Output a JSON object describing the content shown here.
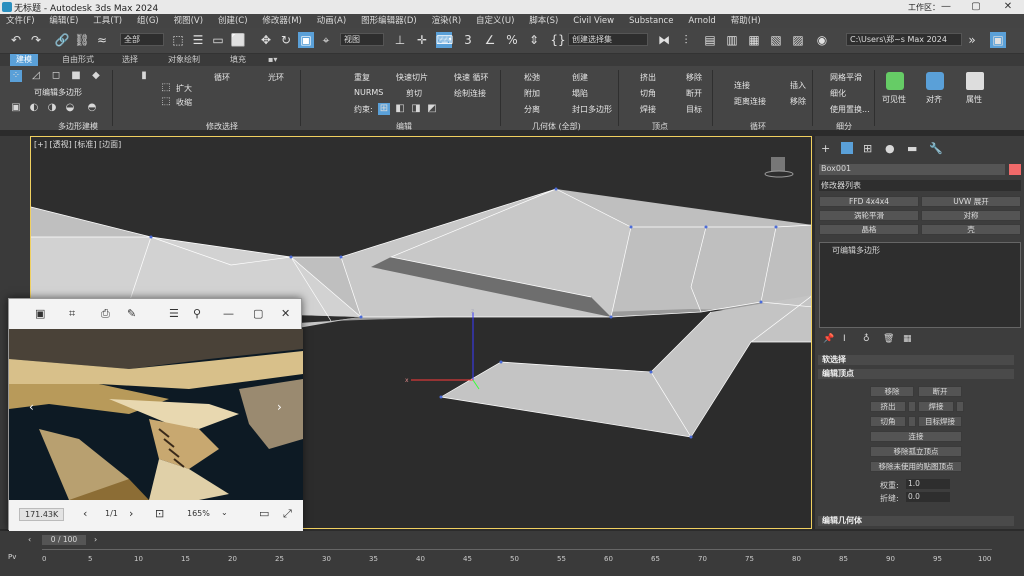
{
  "window": {
    "title": "无标题 - Autodesk 3ds Max 2024",
    "workspace": "工作区：",
    "minimize": "—",
    "maximize": "▢",
    "close": "✕"
  },
  "menu": [
    "文件(F)",
    "编辑(E)",
    "工具(T)",
    "组(G)",
    "视图(V)",
    "创建(C)",
    "修改器(M)",
    "动画(A)",
    "图形编辑器(D)",
    "渲染(R)",
    "自定义(U)",
    "脚本(S)",
    "Civil View",
    "Substance",
    "Arnold",
    "帮助(H)"
  ],
  "toolbar": {
    "selection_filter": "全部",
    "ref_coord": "视图",
    "named_sel": "创建选择集",
    "project_path": "C:\\Users\\郑~s Max 2024"
  },
  "ribbon_tabs": [
    "建模",
    "自由形式",
    "选择",
    "对象绘制",
    "填充"
  ],
  "ribbon": {
    "groups": [
      "多边形建模",
      "修改选择",
      "编辑",
      "几何体 (全部)",
      "顶点",
      "循环",
      "细分"
    ],
    "poly_label": "可编辑多边形",
    "sel": {
      "grow": "扩大",
      "shrink": "收缩",
      "loop": "循环",
      "ring": "光环"
    },
    "edit": {
      "repeat": "重复",
      "quickslice": "快速切片",
      "quickloop": "快速 循环",
      "nurms": "NURMS",
      "cut": "剪切",
      "drawconn": "绘制连接",
      "constraint": "约束:"
    },
    "geo": {
      "relax": "松弛",
      "attach": "附加",
      "split": "分离",
      "create": "创建",
      "collapse": "塌陷",
      "cap": "封口多边形"
    },
    "vertex": {
      "extrude": "挤出",
      "chamfer": "切角",
      "weld": "焊接",
      "remove": "移除",
      "break": "断开",
      "target": "目标"
    },
    "loop": {
      "connect": "连接",
      "distconn": "距离连接",
      "insert": "插入",
      "remove": "移除"
    },
    "subdiv": {
      "meshsmooth": "网格平滑",
      "tessellate": "细化",
      "usedisp": "使用置换..."
    },
    "visibility": "可见性",
    "align": "对齐",
    "props": "属性"
  },
  "viewport": {
    "label": "[+] [透视] [标准] [边面]"
  },
  "photo_viewer": {
    "zoom_btn": "171.43K",
    "page": "1/1",
    "zoom": "165%"
  },
  "command_panel": {
    "object_name": "Box001",
    "object_color": "#f06a6a",
    "modifier_list": "修改器列表",
    "buttons": [
      "FFD 4x4x4",
      "UVW 展开",
      "涡轮平滑",
      "对称",
      "壳",
      "晶格"
    ],
    "stack_item": "可编辑多边形",
    "rollouts": {
      "soft": "软选择",
      "edit_vertex": "编辑顶点",
      "edit_geo": "编辑几何体"
    },
    "ev": {
      "remove": "移除",
      "break": "断开",
      "extrude": "挤出",
      "weld": "焊接",
      "chamfer": "切角",
      "target_weld": "目标焊接",
      "connect": "连接",
      "remove_iso": "移除孤立顶点",
      "remove_unused": "移除未使用的贴图顶点",
      "weight_label": "权重:",
      "weight": "1.0",
      "crease_label": "折缝:",
      "crease": "0.0"
    }
  },
  "timeline": {
    "frame": "0 / 100",
    "ticks": [
      "0",
      "5",
      "10",
      "15",
      "20",
      "25",
      "30",
      "35",
      "40",
      "45",
      "50",
      "55",
      "60",
      "65",
      "70",
      "75",
      "80",
      "85",
      "90",
      "95",
      "100"
    ]
  }
}
